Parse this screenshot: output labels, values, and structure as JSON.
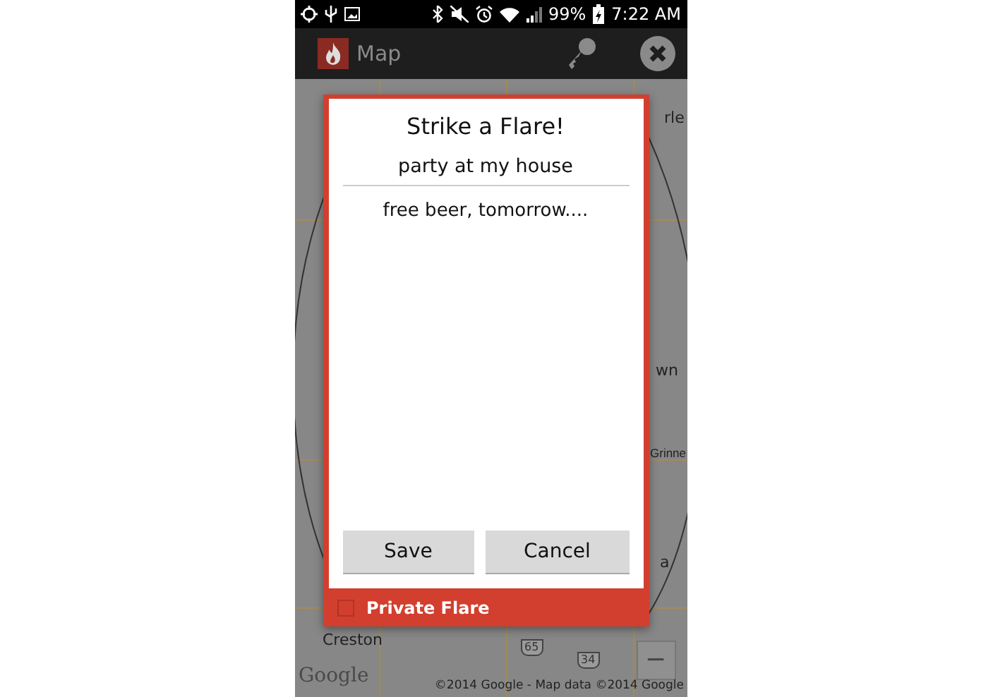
{
  "status_bar": {
    "battery_percent": "99%",
    "time": "7:22 AM"
  },
  "app_bar": {
    "title": "Map"
  },
  "map": {
    "labels": [
      {
        "text": "rle",
        "kind": "place"
      },
      {
        "text": "wn",
        "kind": "place"
      },
      {
        "text": "Grinne",
        "kind": "place"
      },
      {
        "text": "a",
        "kind": "place"
      },
      {
        "text": "Creston",
        "kind": "place"
      },
      {
        "text": "65",
        "kind": "shield"
      },
      {
        "text": "34",
        "kind": "shield"
      }
    ],
    "zoom_out": "−",
    "logo": "Google",
    "attribution": "©2014 Google - Map data ©2014 Google"
  },
  "dialog": {
    "title": "Strike a Flare!",
    "name_value": "party at my house",
    "message_value": "free beer, tomorrow....",
    "buttons": [
      "Save",
      "Cancel"
    ],
    "private": {
      "label": "Private Flare",
      "checked": false
    }
  }
}
